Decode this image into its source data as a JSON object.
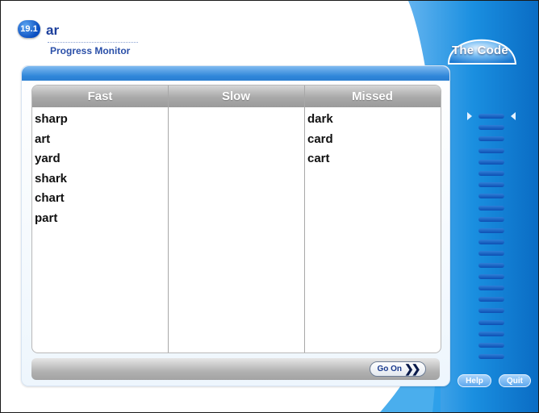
{
  "header": {
    "lesson_number": "19.1",
    "lesson_word": "ar",
    "subtitle": "Progress Monitor"
  },
  "brand": {
    "title": "The Code"
  },
  "table": {
    "columns": [
      "Fast",
      "Slow",
      "Missed"
    ],
    "fast": [
      "sharp",
      "art",
      "yard",
      "shark",
      "chart",
      "part"
    ],
    "slow": [],
    "missed": [
      "dark",
      "card",
      "cart"
    ]
  },
  "footer": {
    "go_on_label": "Go On"
  },
  "controls": {
    "help_label": "Help",
    "quit_label": "Quit"
  },
  "meter": {
    "segments_total": 22,
    "current_position": 1
  },
  "colors": {
    "accent_blue": "#2f86d9",
    "side_blue": "#0d88d8",
    "header_gray": "#a9a9a9",
    "title_blue": "#1c3f9c"
  },
  "icons": {
    "lesson_badge": "circle-badge-icon",
    "go_on": "double-chevron-right-icon",
    "meter_marker": "triangle-marker-icon"
  }
}
